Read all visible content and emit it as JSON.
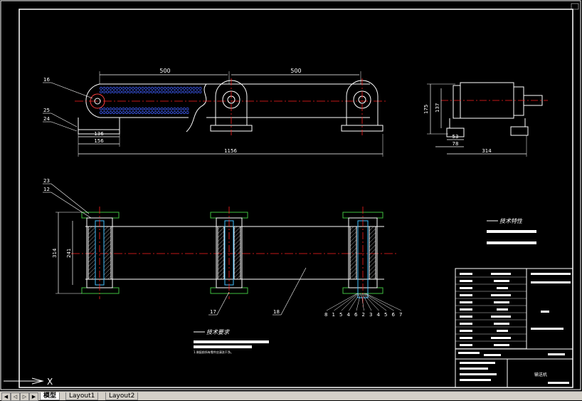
{
  "drawing": {
    "front_view": {
      "dimensions": {
        "top_left": "500",
        "top_right": "500",
        "base_inner": "136",
        "base_outer": "156",
        "overall": "1156"
      },
      "leaders": [
        "16",
        "25",
        "24"
      ]
    },
    "side_view": {
      "dimensions": {
        "height_outer": "175",
        "height_inner": "137",
        "bottom_a": "53",
        "bottom_b": "78",
        "width": "314"
      }
    },
    "top_view": {
      "dimensions": {
        "outer": "314",
        "inner": "241"
      },
      "leaders": [
        "23",
        "12",
        "17",
        "18"
      ],
      "bottom_leaders": [
        "8",
        "1",
        "5",
        "4",
        "6",
        "2",
        "3",
        "4",
        "5",
        "6",
        "7"
      ]
    },
    "notes": {
      "tech_features_title": "技术特性",
      "tech_req_title": "技术要求",
      "tech_req_line": "1.装配前所有零件应清洗干净。"
    },
    "title_block": {
      "company": "",
      "name": "输送机"
    },
    "colors": {
      "background": "#000000",
      "border": "#ffffff",
      "dimension": "#ffffff",
      "centerline": "#ff2020",
      "part": "#ffffff",
      "hatch": "#c0c0c0",
      "chain": "#4060ff",
      "steel": "#40c0ff"
    }
  },
  "tabs": {
    "model": "模型",
    "layout1": "Layout1",
    "layout2": "Layout2"
  },
  "ucs": {
    "label": "X"
  }
}
